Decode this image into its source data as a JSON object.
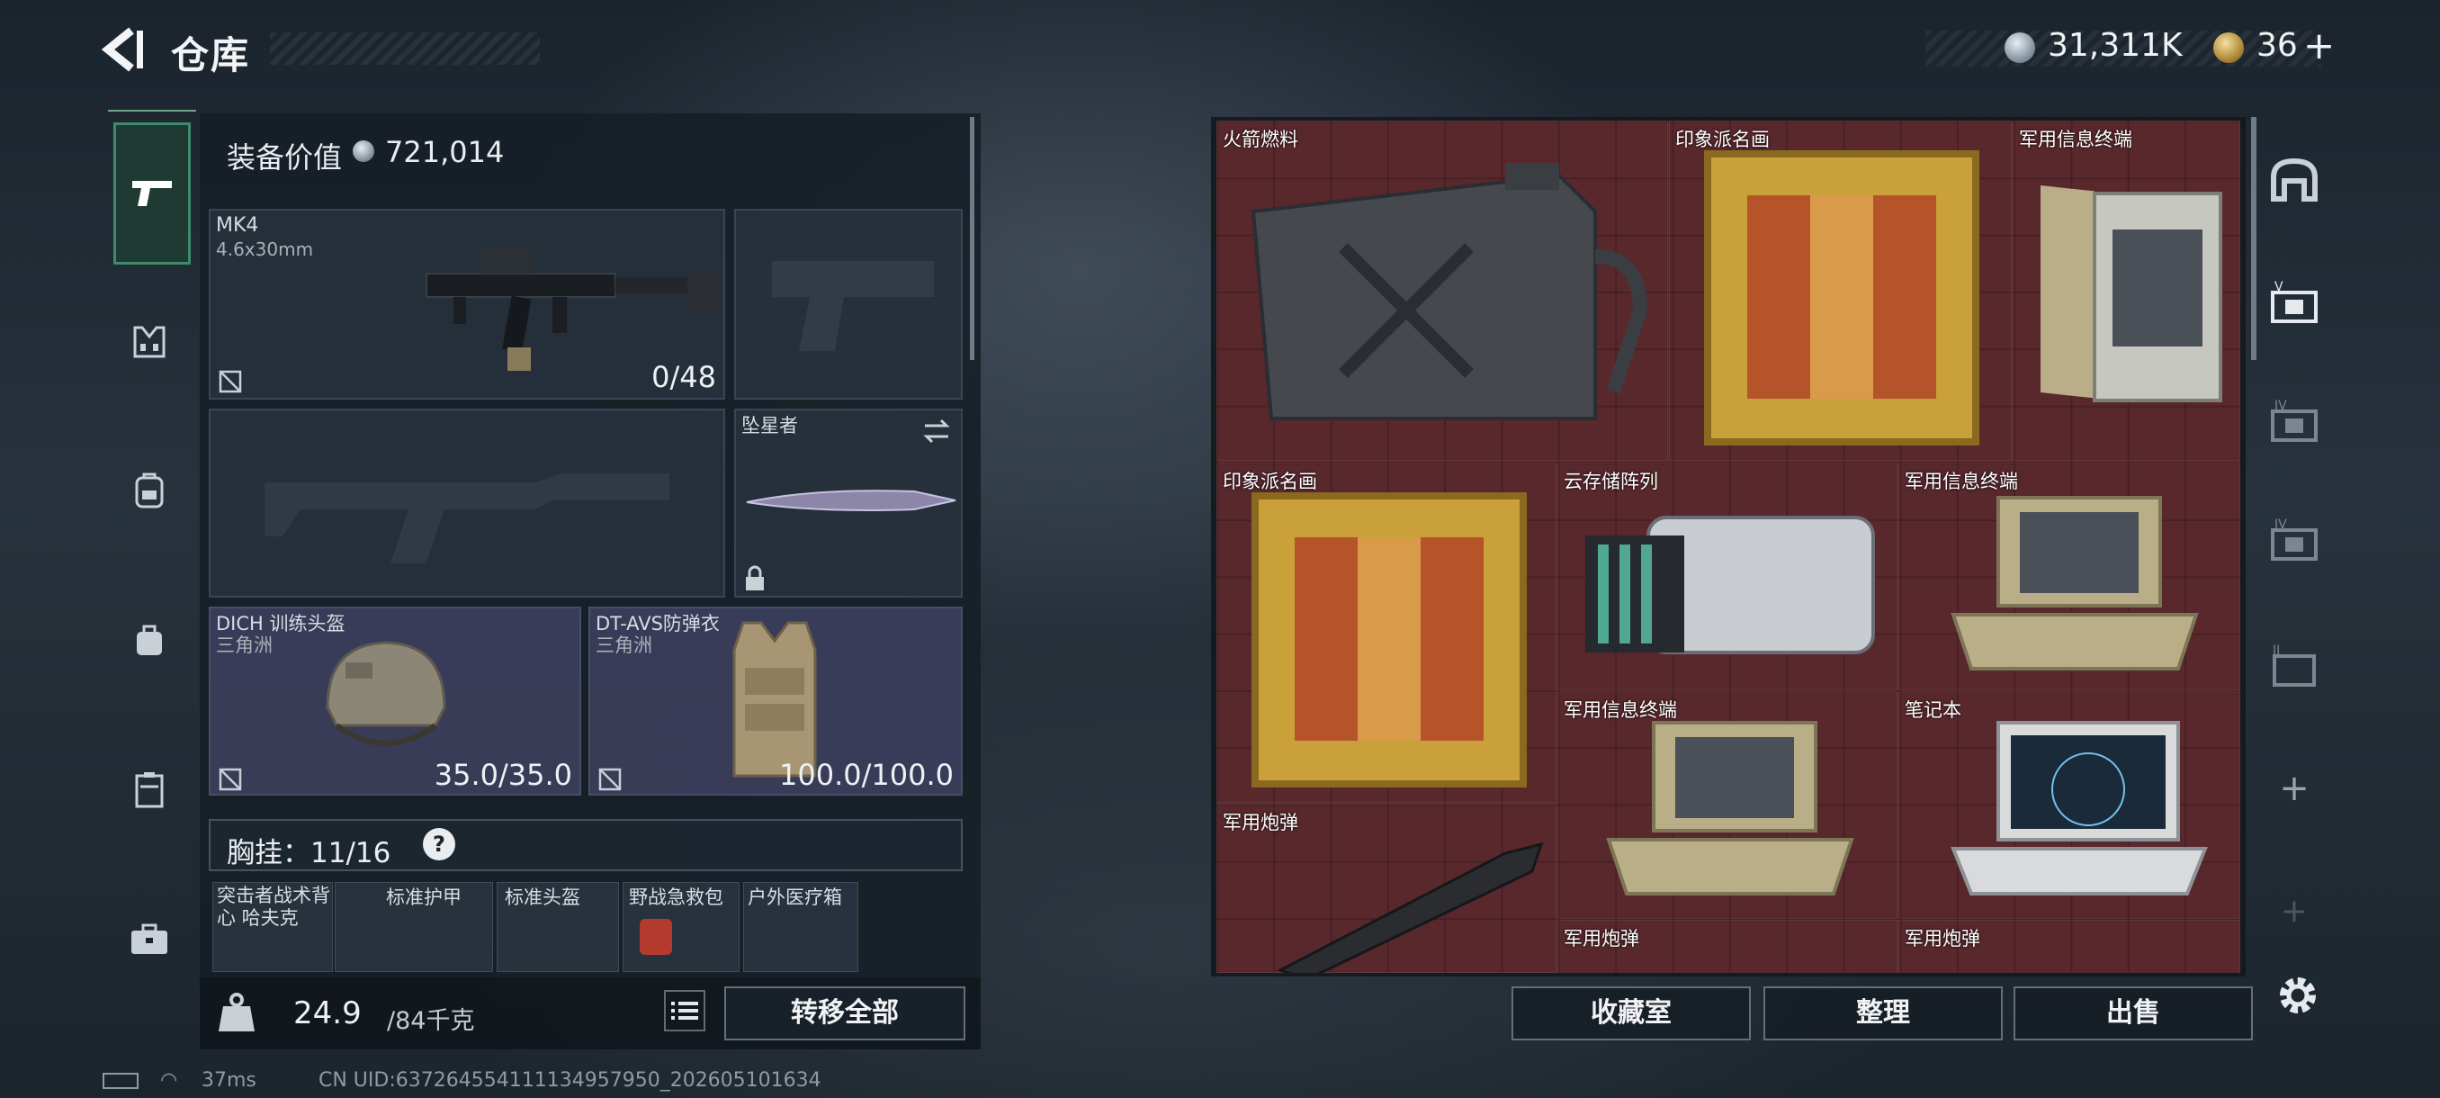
{
  "header": {
    "title": "仓库"
  },
  "currency": {
    "silver": "31,311K",
    "gold": "36",
    "plus": "+"
  },
  "equipment": {
    "value_label": "装备价值",
    "value": "721,014",
    "primary": {
      "name": "MK4",
      "caliber": "4.6x30mm",
      "ammo": "0/48"
    },
    "melee": {
      "name": "坠星者"
    },
    "helmet": {
      "name": "DICH 训练头盔",
      "origin": "三角洲",
      "durability": "35.0/35.0"
    },
    "armor": {
      "name": "DT-AVS防弹衣",
      "origin": "三角洲",
      "durability": "100.0/100.0"
    },
    "rig": {
      "label": "胸挂：",
      "capacity": "11/16",
      "help": "?"
    },
    "rig_items": [
      "突击者战术背心 哈夫克",
      "标准护甲",
      "标准头盔",
      "野战急救包",
      "户外医疗箱"
    ]
  },
  "footer_left": {
    "weight": "24.9",
    "weight_total": "/84千克",
    "transfer_all": "转移全部"
  },
  "status": {
    "ping": "37ms",
    "uid": "CN UID:637264554111134957950_202605101634"
  },
  "warehouse": {
    "items": [
      "火箭燃料",
      "印象派名画",
      "军用信息终端",
      "印象派名画",
      "云存储阵列",
      "军用信息终端",
      "军用信息终端",
      "笔记本",
      "军用炮弹",
      "军用炮弹",
      "军用炮弹"
    ]
  },
  "footer_right": {
    "collection": "收藏室",
    "organize": "整理",
    "sell": "出售"
  },
  "colors": {
    "accent": "#3f8a6d",
    "grid_bg": "#58282d",
    "armor_slot": "#3e4260"
  }
}
